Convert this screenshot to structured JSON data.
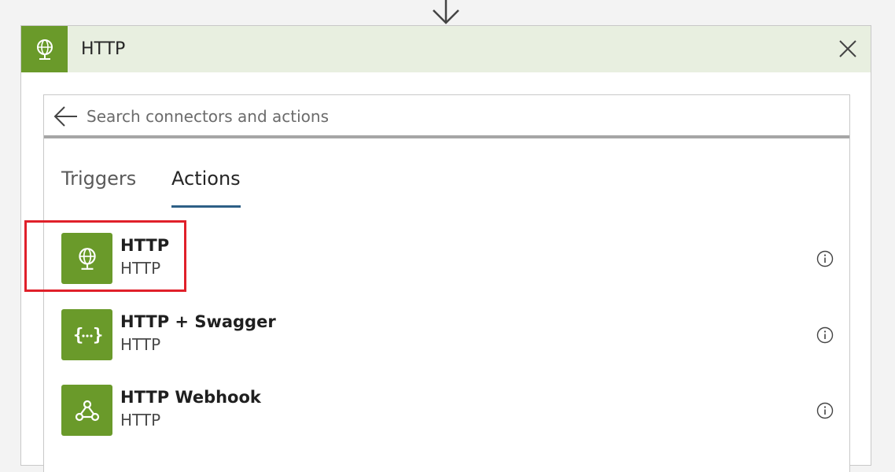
{
  "card": {
    "title": "HTTP",
    "header_icon": "globe-icon",
    "accent_color": "#6a9a2a",
    "header_bg": "#e8efe0"
  },
  "search": {
    "placeholder": "Search connectors and actions",
    "value": ""
  },
  "tabs": [
    {
      "label": "Triggers",
      "selected": false
    },
    {
      "label": "Actions",
      "selected": true
    }
  ],
  "actions": [
    {
      "title": "HTTP",
      "subtitle": "HTTP",
      "icon": "globe-icon",
      "highlighted": true
    },
    {
      "title": "HTTP + Swagger",
      "subtitle": "HTTP",
      "icon": "curly-braces-icon",
      "highlighted": false
    },
    {
      "title": "HTTP Webhook",
      "subtitle": "HTTP",
      "icon": "webhook-icon",
      "highlighted": false
    }
  ],
  "highlight_color": "#e0202a",
  "tab_underline_color": "#2d5f86"
}
